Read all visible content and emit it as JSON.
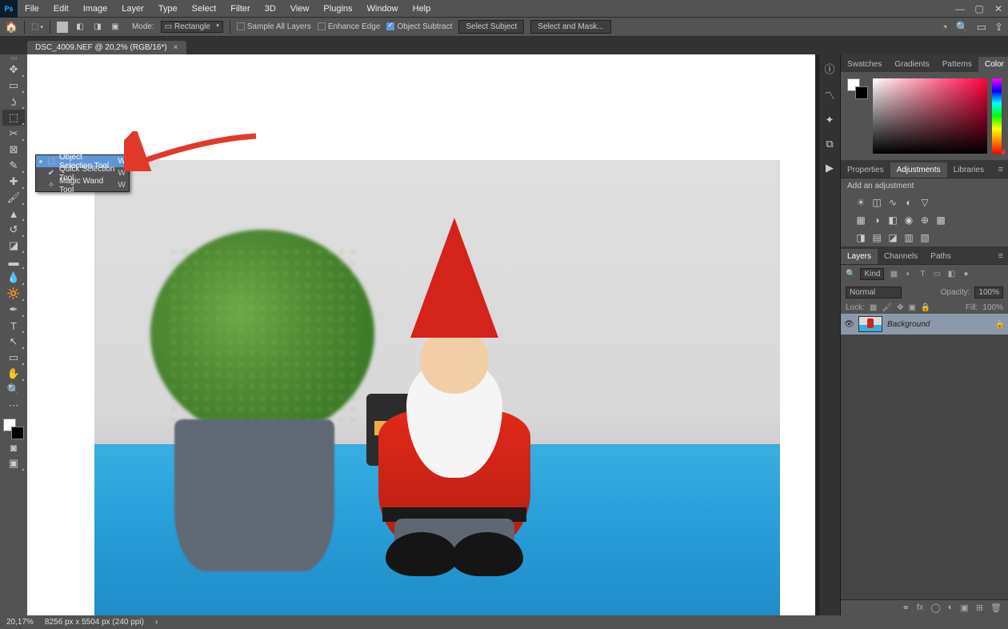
{
  "menubar": [
    "File",
    "Edit",
    "Image",
    "Layer",
    "Type",
    "Select",
    "Filter",
    "3D",
    "View",
    "Plugins",
    "Window",
    "Help"
  ],
  "optionsbar": {
    "mode_label": "Mode:",
    "mode_value": "Rectangle",
    "sample_all": "Sample All Layers",
    "enhance_edge": "Enhance Edge",
    "object_subtract": "Object Subtract",
    "select_subject": "Select Subject",
    "select_and_mask": "Select and Mask..."
  },
  "doc_tab": {
    "title": "DSC_4009.NEF @ 20,2% (RGB/16*)"
  },
  "tool_flyout": {
    "items": [
      {
        "label": "Object Selection Tool",
        "key": "W",
        "selected": true
      },
      {
        "label": "Quick Selection Tool",
        "key": "W",
        "selected": false
      },
      {
        "label": "Magic Wand Tool",
        "key": "W",
        "selected": false
      }
    ]
  },
  "right": {
    "color_tabs": [
      "Swatches",
      "Gradients",
      "Patterns",
      "Color"
    ],
    "color_tab_active": "Color",
    "prop_tabs": [
      "Properties",
      "Adjustments",
      "Libraries"
    ],
    "prop_tab_active": "Adjustments",
    "add_adjustment": "Add an adjustment",
    "layers_tabs": [
      "Layers",
      "Channels",
      "Paths"
    ],
    "layers_tab_active": "Layers",
    "kind_placeholder": "Kind",
    "blend_mode": "Normal",
    "opacity_label": "Opacity:",
    "opacity_value": "100%",
    "lock_label": "Lock:",
    "fill_label": "Fill:",
    "fill_value": "100%",
    "layer_name": "Background"
  },
  "status": {
    "zoom": "20,17%",
    "dims": "8256 px x 5504 px (240 ppi)"
  }
}
